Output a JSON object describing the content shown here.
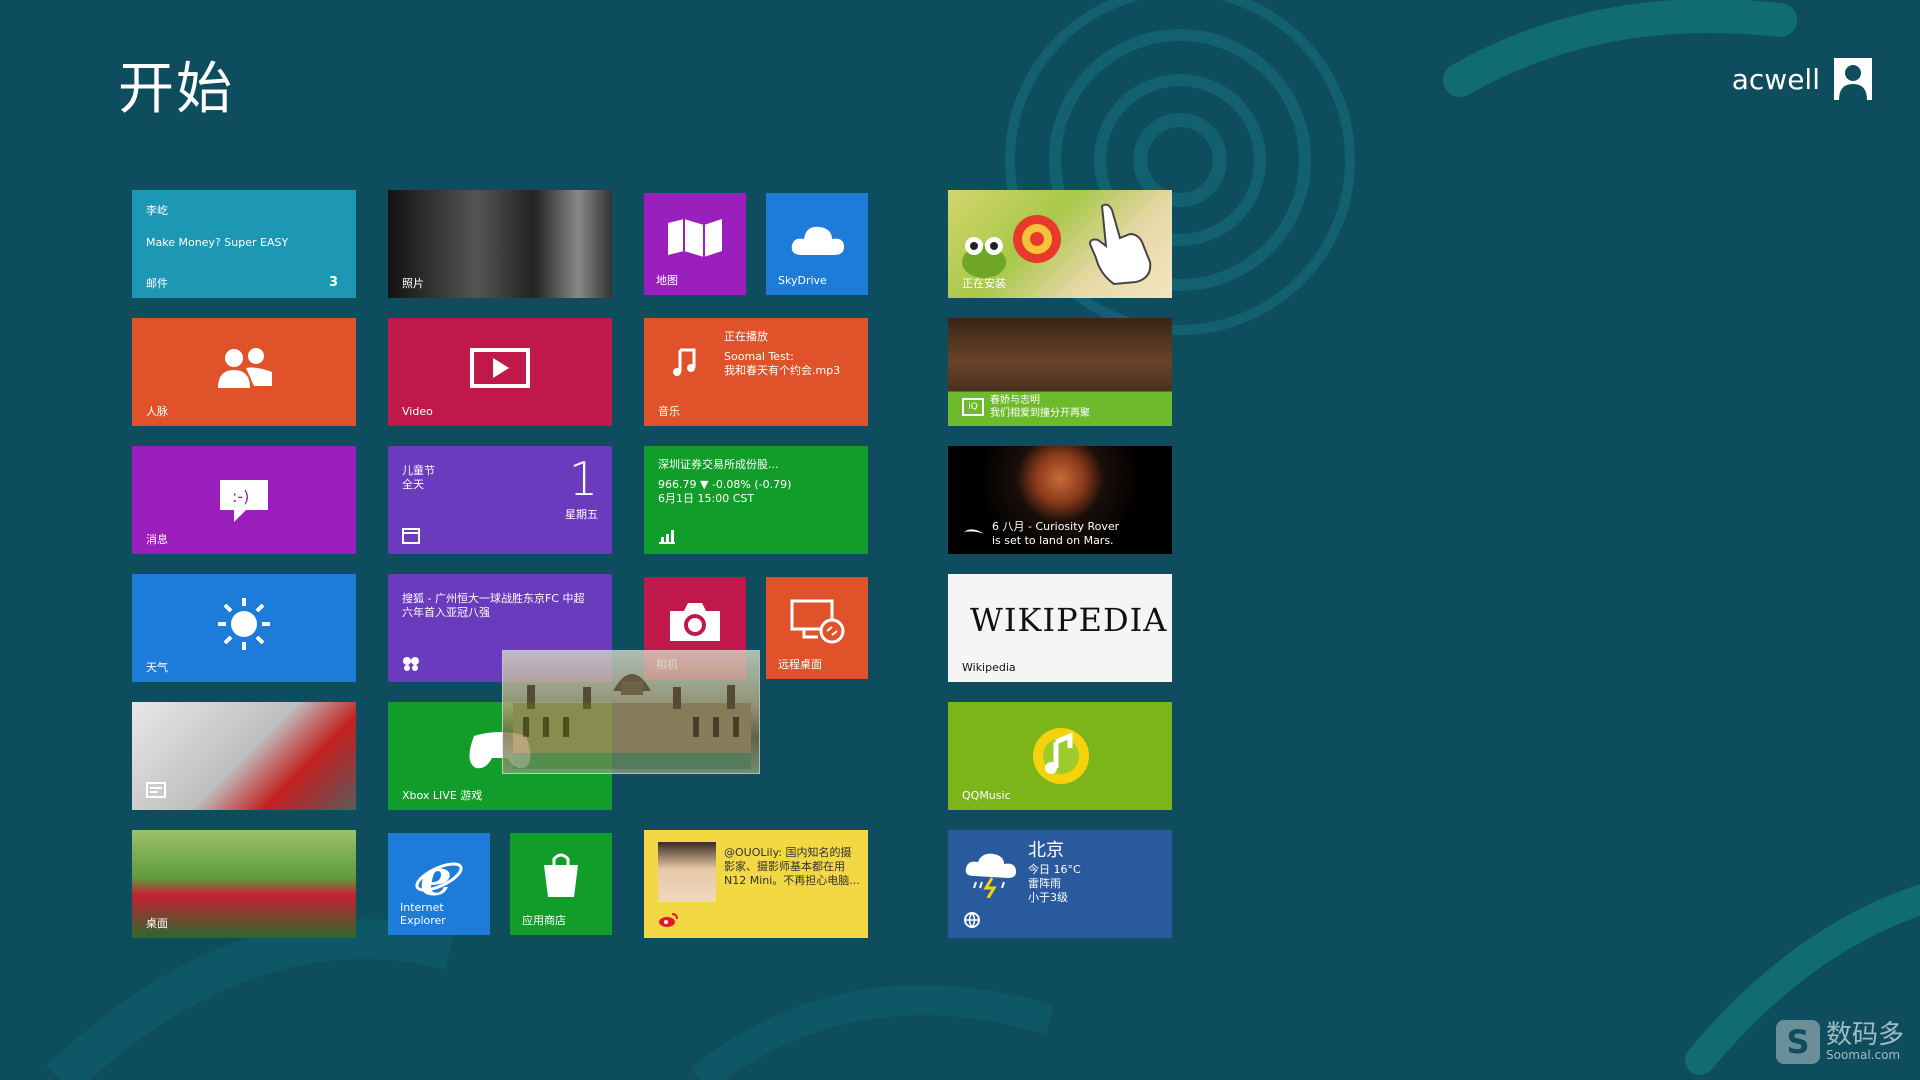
{
  "screen": {
    "title": "开始",
    "username": "acwell"
  },
  "colors": {
    "background": "#0d4d5e",
    "accent": "#1f8c8c"
  },
  "tiles": {
    "mail": {
      "sender": "李屹",
      "subject": "Make Money? Super EASY",
      "label": "邮件",
      "count": "3",
      "color": "#1d98b4"
    },
    "photos": {
      "label": "照片"
    },
    "maps": {
      "label": "地图",
      "color": "#9b1fbd"
    },
    "skydrive": {
      "label": "SkyDrive",
      "color": "#1d7bd9"
    },
    "game_install": {
      "label": "正在安装"
    },
    "people": {
      "label": "人脉",
      "color": "#e0532a"
    },
    "video": {
      "label": "Video",
      "color": "#c1184c"
    },
    "music": {
      "now_playing": "正在播放",
      "artist": "Soomal Test:",
      "track": "我和春天有个约会.mp3",
      "label": "音乐",
      "color": "#e0532a"
    },
    "iqiyi": {
      "line1": "春娇与志明",
      "line2": "我们相爱到撞分开再聚"
    },
    "messaging": {
      "label": "消息",
      "color": "#9b1fbd"
    },
    "calendar": {
      "event": "儿童节",
      "event_time": "全天",
      "day": "1",
      "weekday": "星期五",
      "color": "#6b3bbd"
    },
    "finance": {
      "stock_name": "深圳证券交易所成份股...",
      "quote": "966.79 ▼ -0.08% (-0.79)",
      "time": "6月1日 15:00 CST",
      "color": "#129c2a"
    },
    "space": {
      "line1": "6 八月 - Curiosity Rover",
      "line2": "is set to land on Mars."
    },
    "weather_app": {
      "label": "天气",
      "color": "#1d7bd9"
    },
    "news": {
      "headline_line1": "搜狐 - 广州恒大一球战胜东京FC 中超",
      "headline_line2": "六年首入亚冠八强",
      "color": "#6b3bbd"
    },
    "camera": {
      "label": "相机",
      "color": "#c1184c"
    },
    "remote_desktop": {
      "label": "远程桌面",
      "color": "#e0532a"
    },
    "wikipedia": {
      "logo": "WIKIPEDIA",
      "label": "Wikipedia"
    },
    "xbox": {
      "label": "Xbox LIVE 游戏",
      "color": "#129c2a"
    },
    "qqmusic": {
      "label": "QQMusic",
      "color": "#7cb51a"
    },
    "desktop": {
      "label": "桌面"
    },
    "ie": {
      "label_line1": "Internet",
      "label_line2": "Explorer",
      "color": "#1d7bd9"
    },
    "store": {
      "label": "应用商店",
      "color": "#129c2a"
    },
    "weibo": {
      "line1": "@OUOLily: 国内知名的摄",
      "line2": "影家、摄影师基本都在用",
      "line3": "N12 Mini。不再担心电脑...",
      "color": "#f4d843"
    },
    "weather_live": {
      "city": "北京",
      "temp": "今日 16°C",
      "condition": "雷阵雨",
      "wind": "小于3级",
      "color": "#2a5a9e"
    }
  },
  "watermark": {
    "name": "数码多",
    "site": "Soomal.com"
  }
}
